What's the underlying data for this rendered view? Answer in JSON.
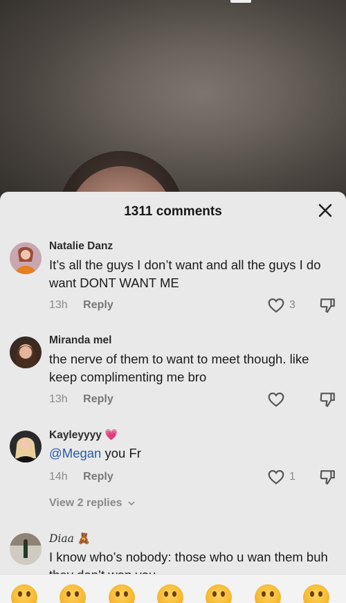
{
  "sheet": {
    "comments_count": "1311 comments"
  },
  "comments": [
    {
      "username": "Natalie Danz",
      "text": "It’s all the guys I don’t want and all the guys I do want DONT WANT ME",
      "time": "13h",
      "reply_label": "Reply",
      "likes": "3"
    },
    {
      "username": "Miranda mel",
      "text": "the nerve of them to want to meet though. like keep complimenting me bro",
      "time": "13h",
      "reply_label": "Reply",
      "likes": ""
    },
    {
      "username": "Kayleyyyy",
      "username_emoji": "💗",
      "mention": "@Megan",
      "text_after_mention": " you Fr",
      "time": "14h",
      "reply_label": "Reply",
      "likes": "1",
      "view_replies": "View 2 replies"
    },
    {
      "username": "Diaa",
      "username_emoji": "🧸",
      "text": "I know who’s nobody: those who u wan them buh they don’t wan you"
    }
  ],
  "emoji_bar": [
    "grinning-face",
    "smiling-face-with-hearts",
    "face-with-tears-of-joy",
    "flushed-face",
    "smirking-face",
    "grinning-face-with-sweat",
    "pleading-face"
  ],
  "colors": {
    "sheet_bg": "#e9e9e9",
    "mention": "#2a5aa8",
    "muted": "#8a8a8a"
  }
}
